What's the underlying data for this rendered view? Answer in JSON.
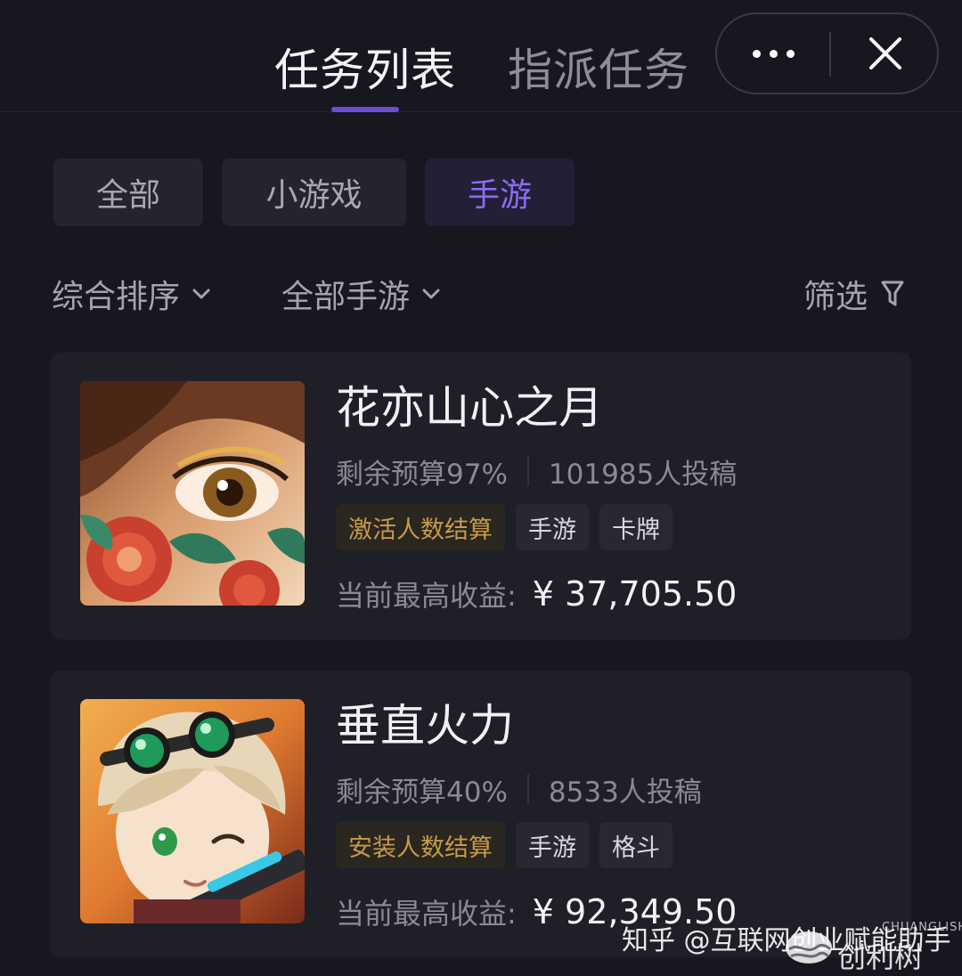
{
  "header": {
    "tabs": [
      {
        "label": "任务列表",
        "active": true
      },
      {
        "label": "指派任务",
        "active": false
      }
    ],
    "more_icon": "more-dots-icon",
    "close_icon": "close-icon"
  },
  "category_filters": [
    {
      "label": "全部",
      "selected": false
    },
    {
      "label": "小游戏",
      "selected": false
    },
    {
      "label": "手游",
      "selected": true
    }
  ],
  "sort_bar": {
    "sort_label": "综合排序",
    "game_filter_label": "全部手游",
    "filter_label": "筛选"
  },
  "tasks": [
    {
      "title": "花亦山心之月",
      "budget": "剩余预算97%",
      "submissions": "101985人投稿",
      "tags": [
        "激活人数结算",
        "手游",
        "卡牌"
      ],
      "earnings_label": "当前最高收益:",
      "earnings_value": "¥ 37,705.50"
    },
    {
      "title": "垂直火力",
      "budget": "剩余预算40%",
      "submissions": "8533人投稿",
      "tags": [
        "安装人数结算",
        "手游",
        "格斗"
      ],
      "earnings_label": "当前最高收益:",
      "earnings_value": "¥ 92,349.50"
    }
  ],
  "watermark": {
    "text": "知乎 @互联网创业赋能助手",
    "brand": "创利树",
    "latin": "CHUANGLISHU"
  },
  "colors": {
    "background": "#17171f",
    "card": "#1f1f28",
    "accent_purple": "#6d4cd6",
    "selected_purple_text": "#8c6cf0",
    "gold_tag_text": "#c79a4a"
  }
}
